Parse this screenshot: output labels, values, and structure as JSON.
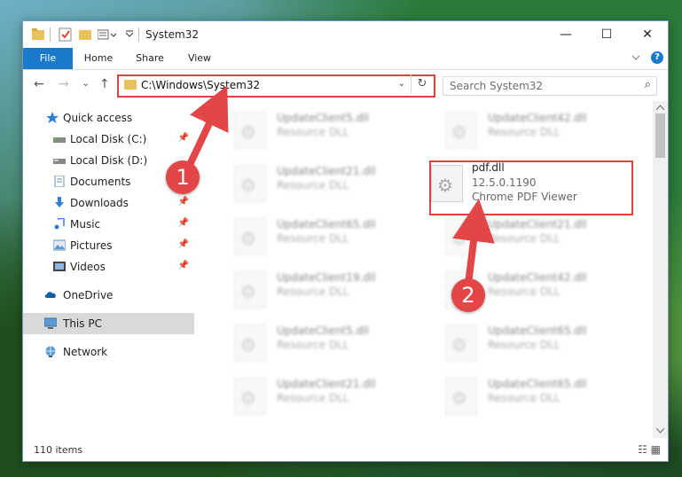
{
  "window": {
    "title": "System32",
    "controls": {
      "minimize": "—",
      "maximize": "☐",
      "close": "✕"
    }
  },
  "ribbon": {
    "tabs": [
      "File",
      "Home",
      "Share",
      "View"
    ],
    "help": "?"
  },
  "nav": {
    "back": "←",
    "forward": "→",
    "recent": "⌄",
    "up": "↑",
    "address": "C:\\Windows\\System32",
    "address_chevron": "⌄",
    "refresh": "↻",
    "search_placeholder": "Search System32",
    "search_icon": "⌕"
  },
  "sidebar": {
    "items": [
      {
        "label": "Quick access",
        "icon": "star-icon",
        "pinned": false
      },
      {
        "label": "Local Disk (C:)",
        "icon": "drive-icon",
        "pinned": true
      },
      {
        "label": "Local Disk (D:)",
        "icon": "drive-icon",
        "pinned": false
      },
      {
        "label": "Documents",
        "icon": "documents-icon",
        "pinned": true
      },
      {
        "label": "Downloads",
        "icon": "download-icon",
        "pinned": true
      },
      {
        "label": "Music",
        "icon": "music-icon",
        "pinned": true
      },
      {
        "label": "Pictures",
        "icon": "pictures-icon",
        "pinned": true
      },
      {
        "label": "Videos",
        "icon": "videos-icon",
        "pinned": true
      },
      {
        "label": "OneDrive",
        "icon": "cloud-icon",
        "pinned": false
      },
      {
        "label": "This PC",
        "icon": "computer-icon",
        "pinned": false,
        "selected": true
      },
      {
        "label": "Network",
        "icon": "network-icon",
        "pinned": false
      }
    ],
    "pin_glyph": "📌"
  },
  "files": [
    {
      "name": "UpdateClient5.dll",
      "sub": "Resource DLL"
    },
    {
      "name": "UpdateClient42.dll",
      "sub": "Resource DLL"
    },
    {
      "name": "UpdateClient21.dll",
      "sub": "Resource DLL"
    },
    {
      "name": "pdf.dll",
      "version": "12.5.0.1190",
      "sub": "Chrome PDF Viewer",
      "highlighted": true
    },
    {
      "name": "UpdateClient65.dll",
      "sub": "Resource DLL"
    },
    {
      "name": "UpdateClient21.dll",
      "sub": "Resource DLL"
    },
    {
      "name": "UpdateClient19.dll",
      "sub": "Resource DLL"
    },
    {
      "name": "UpdateClient42.dll",
      "sub": "Resource DLL"
    },
    {
      "name": "UpdateClient5.dll",
      "sub": "Resource DLL"
    },
    {
      "name": "UpdateClient65.dll",
      "sub": "Resource DLL"
    },
    {
      "name": "UpdateClient21.dll",
      "sub": "Resource DLL"
    },
    {
      "name": "UpdateClient65.dll",
      "sub": "Resource DLL"
    }
  ],
  "status": {
    "count": "110 items",
    "views": "☷ ▦"
  },
  "callouts": [
    "1",
    "2"
  ],
  "colors": {
    "accent": "#1979ca",
    "highlight": "#e04040",
    "callout": "#e24646",
    "selected": "#d9d9d9"
  }
}
